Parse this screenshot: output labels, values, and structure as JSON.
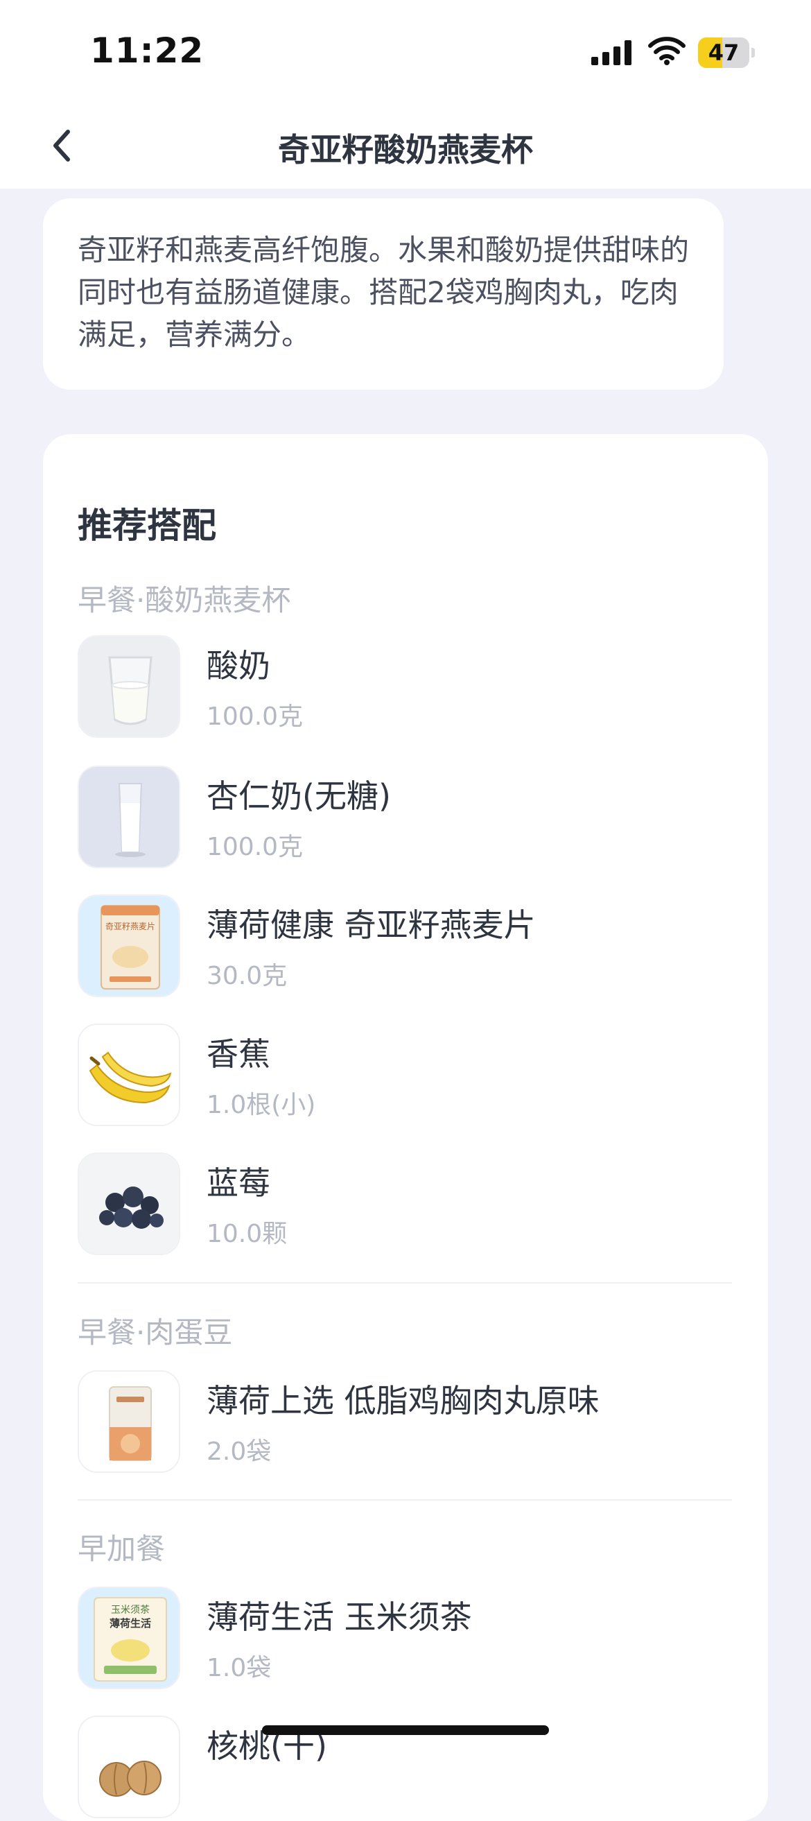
{
  "status_bar": {
    "time": "11:22",
    "battery_level": "47",
    "battery_fraction": 0.47,
    "icons": [
      "signal-icon",
      "wifi-icon",
      "battery-icon"
    ]
  },
  "nav": {
    "title": "奇亚籽酸奶燕麦杯",
    "back_icon": "chevron-left-icon"
  },
  "intro": {
    "text": "奇亚籽和燕麦高纤饱腹。水果和酸奶提供甜味的同时也有益肠道健康。搭配2袋鸡胸肉丸，吃肉满足，营养满分。"
  },
  "recommend": {
    "title": "推荐搭配",
    "groups": [
      {
        "title": "早餐·酸奶燕麦杯",
        "items": [
          {
            "name": "酸奶",
            "amount": "100.0克"
          },
          {
            "name": "杏仁奶(无糖)",
            "amount": "100.0克"
          },
          {
            "name": "薄荷健康 奇亚籽燕麦片",
            "amount": "30.0克"
          },
          {
            "name": "香蕉",
            "amount": "1.0根(小)"
          },
          {
            "name": "蓝莓",
            "amount": "10.0颗"
          }
        ]
      },
      {
        "title": "早餐·肉蛋豆",
        "items": [
          {
            "name": "薄荷上选 低脂鸡胸肉丸原味",
            "amount": "2.0袋"
          }
        ]
      },
      {
        "title": "早加餐",
        "items": [
          {
            "name": "薄荷生活 玉米须茶",
            "amount": "1.0袋"
          },
          {
            "name": "核桃(干)",
            "amount": ""
          }
        ]
      }
    ],
    "thumb_labels": {
      "oat_pack": "奇亚籽燕麦片",
      "tea_brand": "玉米须茶",
      "tea_title": "薄荷生活"
    }
  },
  "colors": {
    "page_bg": "#f1f2f9",
    "card_bg": "#ffffff",
    "title_text": "#2e3440",
    "muted_text": "#b3b8c3",
    "battery_accent": "#f6cf1d"
  }
}
